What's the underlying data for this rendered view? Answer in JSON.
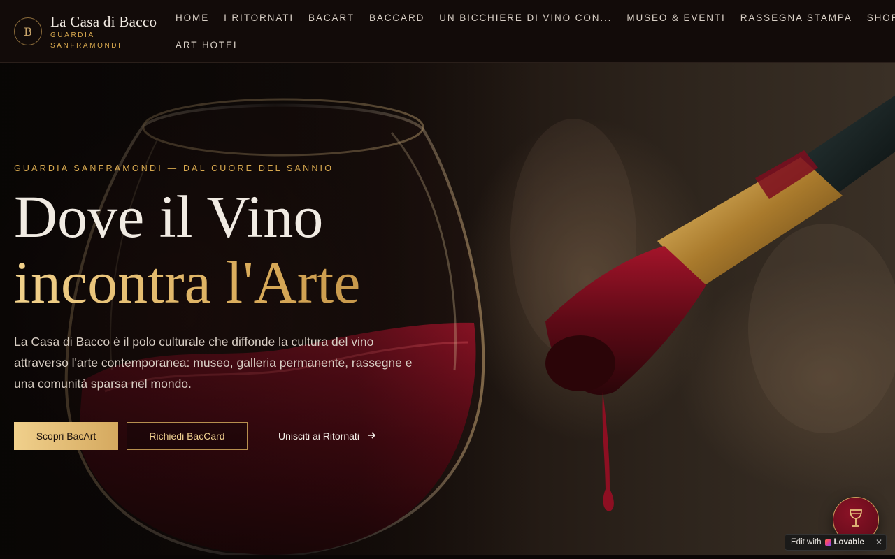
{
  "brand": {
    "mark": "B",
    "title": "La Casa di Bacco",
    "subtitle": "GUARDIA SANFRAMONDI"
  },
  "nav": {
    "row1": [
      "HOME",
      "I RITORNATI",
      "BACART",
      "BACCARD",
      "UN BICCHIERE DI VINO CON...",
      "MUSEO & EVENTI",
      "RASSEGNA STAMPA",
      "SHOP"
    ],
    "row2": [
      "ART HOTEL"
    ]
  },
  "hero": {
    "eyebrow": "GUARDIA SANFRAMONDI — DAL CUORE DEL SANNIO",
    "headline_line1": "Dove il Vino",
    "headline_line2": "incontra l'Arte",
    "lead": "La Casa di Bacco è il polo culturale che diffonde la cultura del vino attraverso l'arte contemporanea: museo, galleria permanente, rassegne e una comunità sparsa nel mondo.",
    "buttons": {
      "primary": "Scopri BacArt",
      "secondary": "Richiedi BacCard",
      "link": "Unisciti ai Ritornati"
    }
  },
  "widgets": {
    "fab_icon": "wine-glass-icon",
    "edit_with": "Edit with",
    "lovable": "Lovable",
    "close": "✕"
  },
  "colors": {
    "gold": "#d8a94f",
    "wine": "#7a0f22",
    "header_bg": "#120b09"
  }
}
